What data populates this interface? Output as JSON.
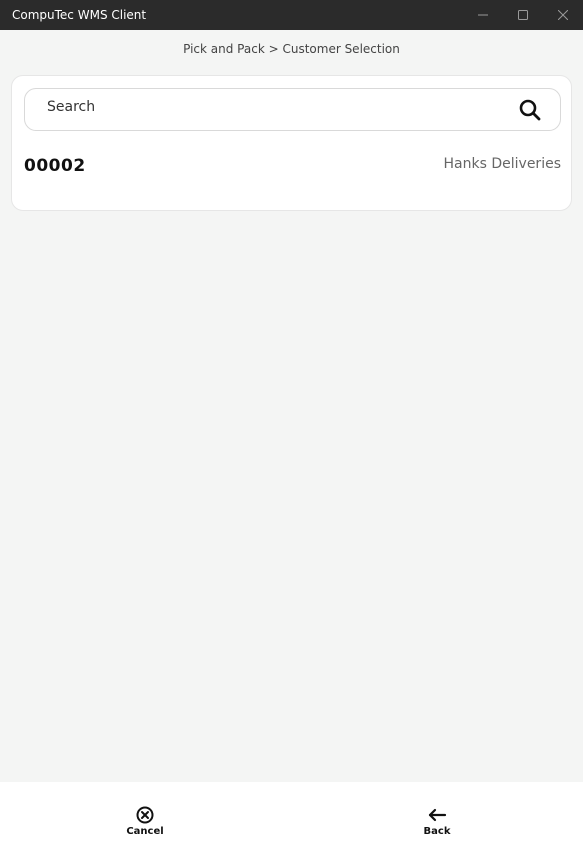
{
  "window": {
    "title": "CompuTec WMS Client",
    "controls": {
      "minimize": "minimize-icon",
      "maximize": "maximize-icon",
      "close": "close-icon"
    }
  },
  "breadcrumb": "Pick and Pack > Customer Selection",
  "search": {
    "placeholder": "Search",
    "icon": "search-icon"
  },
  "customers": [
    {
      "code": "00002",
      "name": "Hanks Deliveries"
    }
  ],
  "footer": {
    "cancel_label": "Cancel",
    "cancel_icon": "cancel-circle-icon",
    "back_label": "Back",
    "back_icon": "arrow-left-icon"
  }
}
